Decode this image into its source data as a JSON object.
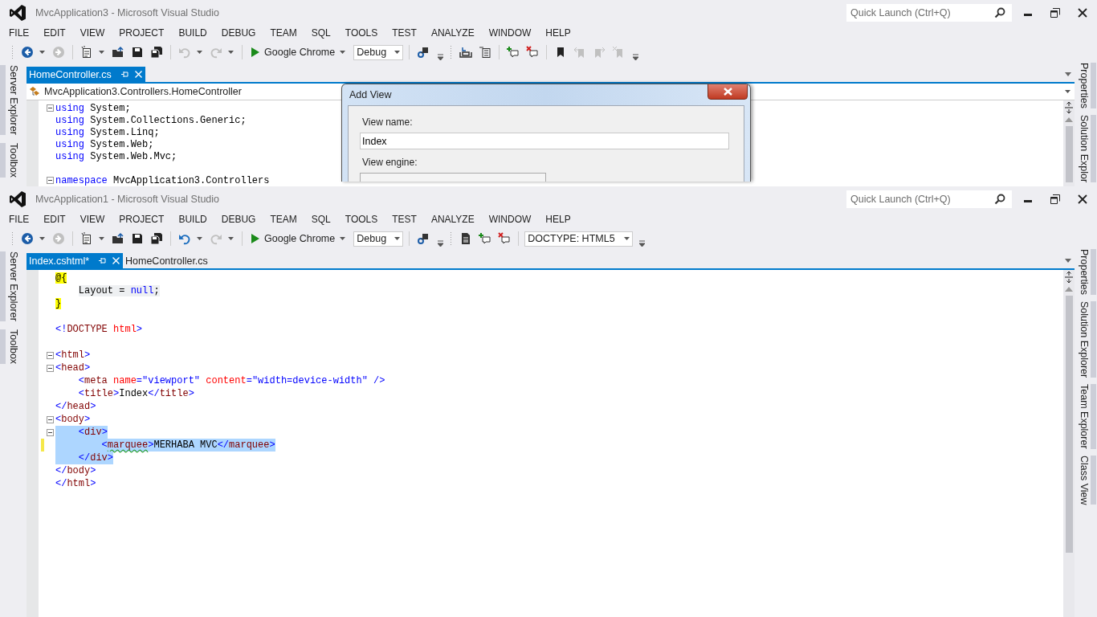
{
  "windows": [
    {
      "title": "MvcApplication3 - Microsoft Visual Studio",
      "quick_launch": {
        "placeholder": "Quick Launch (Ctrl+Q)"
      },
      "menu": [
        "FILE",
        "EDIT",
        "VIEW",
        "PROJECT",
        "BUILD",
        "DEBUG",
        "TEAM",
        "SQL",
        "TOOLS",
        "TEST",
        "ANALYZE",
        "WINDOW",
        "HELP"
      ],
      "toolbar": [
        {
          "kind": "grip"
        },
        {
          "kind": "back",
          "disabled": false
        },
        {
          "kind": "caret"
        },
        {
          "kind": "forward",
          "disabled": true
        },
        {
          "kind": "separator"
        },
        {
          "kind": "new",
          "disabled": false
        },
        {
          "kind": "caret"
        },
        {
          "kind": "open",
          "disabled": false
        },
        {
          "kind": "save",
          "disabled": false
        },
        {
          "kind": "saveall",
          "disabled": false
        },
        {
          "kind": "separator"
        },
        {
          "kind": "undo",
          "disabled": true
        },
        {
          "kind": "caret"
        },
        {
          "kind": "redo",
          "disabled": true
        },
        {
          "kind": "caret"
        },
        {
          "kind": "separator"
        },
        {
          "kind": "start",
          "label": "Google Chrome"
        },
        {
          "kind": "combo",
          "value": "Debug"
        },
        {
          "kind": "separator"
        },
        {
          "kind": "find",
          "disabled": false
        },
        {
          "kind": "overflow"
        },
        {
          "kind": "grip"
        },
        {
          "kind": "tray",
          "disabled": false
        },
        {
          "kind": "list",
          "disabled": false
        },
        {
          "kind": "separator"
        },
        {
          "kind": "comment",
          "disabled": false
        },
        {
          "kind": "uncomment",
          "disabled": false
        },
        {
          "kind": "separator"
        },
        {
          "kind": "bookmark",
          "disabled": false
        },
        {
          "kind": "bookmark-prev",
          "disabled": true
        },
        {
          "kind": "bookmark-next",
          "disabled": true
        },
        {
          "kind": "bookmark-clear",
          "disabled": true
        },
        {
          "kind": "overflow"
        }
      ],
      "left_panels": [
        "Server Explorer",
        "Toolbox"
      ],
      "right_panels": [
        "Properties",
        "Solution Explor"
      ],
      "tabs": [
        {
          "label": "HomeController.cs",
          "selected": true
        }
      ],
      "nav_bar": {
        "path": "MvcApplication3.Controllers.HomeController"
      },
      "code": [
        {
          "kind": "line",
          "fold": true,
          "selected": false,
          "changed": false,
          "segments": [
            {
              "kind": "keyword",
              "text": "using"
            },
            {
              "kind": "text",
              "text": " System;"
            }
          ]
        },
        {
          "kind": "line",
          "fold": false,
          "selected": false,
          "changed": false,
          "segments": [
            {
              "kind": "keyword",
              "text": "using"
            },
            {
              "kind": "text",
              "text": " System.Collections.Generic;"
            }
          ]
        },
        {
          "kind": "line",
          "fold": false,
          "selected": false,
          "changed": false,
          "segments": [
            {
              "kind": "keyword",
              "text": "using"
            },
            {
              "kind": "text",
              "text": " System.Linq;"
            }
          ]
        },
        {
          "kind": "line",
          "fold": false,
          "selected": false,
          "changed": false,
          "segments": [
            {
              "kind": "keyword",
              "text": "using"
            },
            {
              "kind": "text",
              "text": " System.Web;"
            }
          ]
        },
        {
          "kind": "line",
          "fold": false,
          "selected": false,
          "changed": false,
          "segments": [
            {
              "kind": "keyword",
              "text": "using"
            },
            {
              "kind": "text",
              "text": " System.Web.Mvc;"
            }
          ]
        },
        {
          "kind": "blank"
        },
        {
          "kind": "line",
          "fold": true,
          "selected": false,
          "changed": false,
          "segments": [
            {
              "kind": "keyword",
              "text": "namespace"
            },
            {
              "kind": "text",
              "text": " MvcApplication3.Controllers"
            }
          ]
        }
      ],
      "dialog": {
        "title": "Add View",
        "fields": [
          {
            "kind": "text",
            "label": "View name:",
            "value": "Index"
          },
          {
            "kind": "select",
            "label": "View engine:"
          }
        ]
      }
    },
    {
      "title": "MvcApplication1 - Microsoft Visual Studio",
      "quick_launch": {
        "placeholder": "Quick Launch (Ctrl+Q)"
      },
      "menu": [
        "FILE",
        "EDIT",
        "VIEW",
        "PROJECT",
        "BUILD",
        "DEBUG",
        "TEAM",
        "SQL",
        "TOOLS",
        "TEST",
        "ANALYZE",
        "WINDOW",
        "HELP"
      ],
      "toolbar": [
        {
          "kind": "grip"
        },
        {
          "kind": "back",
          "disabled": false
        },
        {
          "kind": "caret"
        },
        {
          "kind": "forward",
          "disabled": true
        },
        {
          "kind": "separator"
        },
        {
          "kind": "new",
          "disabled": false
        },
        {
          "kind": "caret"
        },
        {
          "kind": "open",
          "disabled": false
        },
        {
          "kind": "save",
          "disabled": false
        },
        {
          "kind": "saveall",
          "disabled": false
        },
        {
          "kind": "separator"
        },
        {
          "kind": "undo",
          "disabled": false
        },
        {
          "kind": "caret"
        },
        {
          "kind": "redo",
          "disabled": true
        },
        {
          "kind": "caret"
        },
        {
          "kind": "separator"
        },
        {
          "kind": "start",
          "label": "Google Chrome"
        },
        {
          "kind": "combo",
          "value": "Debug"
        },
        {
          "kind": "separator"
        },
        {
          "kind": "find",
          "disabled": false
        },
        {
          "kind": "overflow"
        },
        {
          "kind": "grip"
        },
        {
          "kind": "doc",
          "disabled": false
        },
        {
          "kind": "comment",
          "disabled": false
        },
        {
          "kind": "uncomment",
          "disabled": false
        },
        {
          "kind": "separator"
        },
        {
          "kind": "combo-wide",
          "value": "DOCTYPE: HTML5"
        },
        {
          "kind": "overflow"
        }
      ],
      "left_panels": [
        "Server Explorer",
        "Toolbox"
      ],
      "right_panels": [
        "Properties",
        "Solution Explorer",
        "Team Explorer",
        "Class View"
      ],
      "tabs": [
        {
          "label": "Index.cshtml*",
          "selected": true
        },
        {
          "label": "HomeController.cs",
          "selected": false
        }
      ],
      "code": [
        {
          "kind": "line",
          "fold": false,
          "selected": false,
          "changed": false,
          "segments": [
            {
              "kind": "razor",
              "text": "@{"
            }
          ]
        },
        {
          "kind": "line",
          "fold": false,
          "selected": false,
          "changed": false,
          "segments": [
            {
              "kind": "code",
              "text": "    Layout = "
            },
            {
              "kind": "code-keyword",
              "text": "null"
            },
            {
              "kind": "code",
              "text": ";"
            }
          ]
        },
        {
          "kind": "line",
          "fold": false,
          "selected": false,
          "changed": false,
          "segments": [
            {
              "kind": "razor",
              "text": "}"
            }
          ]
        },
        {
          "kind": "blank"
        },
        {
          "kind": "line",
          "fold": false,
          "selected": false,
          "changed": false,
          "segments": [
            {
              "kind": "delim",
              "text": "<!"
            },
            {
              "kind": "tag",
              "text": "DOCTYPE"
            },
            {
              "kind": "attr",
              "text": " html"
            },
            {
              "kind": "delim",
              "text": ">"
            }
          ]
        },
        {
          "kind": "blank"
        },
        {
          "kind": "line",
          "fold": true,
          "selected": false,
          "changed": false,
          "segments": [
            {
              "kind": "delim",
              "text": "<"
            },
            {
              "kind": "tag",
              "text": "html"
            },
            {
              "kind": "delim",
              "text": ">"
            }
          ]
        },
        {
          "kind": "line",
          "fold": true,
          "selected": false,
          "changed": false,
          "segments": [
            {
              "kind": "delim",
              "text": "<"
            },
            {
              "kind": "tag",
              "text": "head"
            },
            {
              "kind": "delim",
              "text": ">"
            }
          ]
        },
        {
          "kind": "line",
          "fold": false,
          "selected": false,
          "changed": false,
          "segments": [
            {
              "kind": "delim",
              "text": "    <"
            },
            {
              "kind": "tag",
              "text": "meta"
            },
            {
              "kind": "attr",
              "text": " name"
            },
            {
              "kind": "delim",
              "text": "="
            },
            {
              "kind": "value",
              "text": "\"viewport\""
            },
            {
              "kind": "attr",
              "text": " content"
            },
            {
              "kind": "delim",
              "text": "="
            },
            {
              "kind": "value",
              "text": "\"width=device-width\""
            },
            {
              "kind": "delim",
              "text": " />"
            }
          ]
        },
        {
          "kind": "line",
          "fold": false,
          "selected": false,
          "changed": false,
          "segments": [
            {
              "kind": "delim",
              "text": "    <"
            },
            {
              "kind": "tag",
              "text": "title"
            },
            {
              "kind": "delim",
              "text": ">"
            },
            {
              "kind": "text",
              "text": "Index"
            },
            {
              "kind": "delim",
              "text": "</"
            },
            {
              "kind": "tag",
              "text": "title"
            },
            {
              "kind": "delim",
              "text": ">"
            }
          ]
        },
        {
          "kind": "line",
          "fold": false,
          "selected": false,
          "changed": false,
          "segments": [
            {
              "kind": "delim",
              "text": "</"
            },
            {
              "kind": "tag",
              "text": "head"
            },
            {
              "kind": "delim",
              "text": ">"
            }
          ]
        },
        {
          "kind": "line",
          "fold": true,
          "selected": false,
          "changed": false,
          "segments": [
            {
              "kind": "delim",
              "text": "<"
            },
            {
              "kind": "tag",
              "text": "body"
            },
            {
              "kind": "delim",
              "text": ">"
            }
          ]
        },
        {
          "kind": "line",
          "fold": true,
          "selected": true,
          "changed": false,
          "segments": [
            {
              "kind": "delim",
              "text": "    <"
            },
            {
              "kind": "tag",
              "text": "div"
            },
            {
              "kind": "delim",
              "text": ">"
            }
          ]
        },
        {
          "kind": "line",
          "fold": false,
          "selected": true,
          "changed": true,
          "segments": [
            {
              "kind": "delim",
              "text": "        <"
            },
            {
              "kind": "tag",
              "text": "marquee",
              "error": true
            },
            {
              "kind": "delim",
              "text": ">"
            },
            {
              "kind": "text",
              "text": "MERHABA MVC"
            },
            {
              "kind": "delim",
              "text": "</"
            },
            {
              "kind": "tag",
              "text": "marquee"
            },
            {
              "kind": "delim",
              "text": ">"
            }
          ]
        },
        {
          "kind": "line",
          "fold": false,
          "selected": true,
          "changed": false,
          "segments": [
            {
              "kind": "delim",
              "text": "    </"
            },
            {
              "kind": "tag",
              "text": "div"
            },
            {
              "kind": "delim",
              "text": ">"
            }
          ]
        },
        {
          "kind": "line",
          "fold": false,
          "selected": false,
          "changed": false,
          "segments": [
            {
              "kind": "delim",
              "text": "</"
            },
            {
              "kind": "tag",
              "text": "body"
            },
            {
              "kind": "delim",
              "text": ">"
            }
          ]
        },
        {
          "kind": "line",
          "fold": false,
          "selected": false,
          "changed": false,
          "segments": [
            {
              "kind": "delim",
              "text": "</"
            },
            {
              "kind": "tag",
              "text": "html"
            },
            {
              "kind": "delim",
              "text": ">"
            }
          ]
        }
      ]
    }
  ]
}
